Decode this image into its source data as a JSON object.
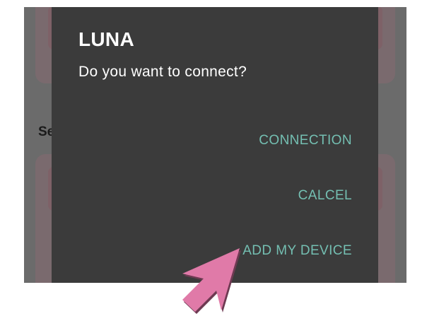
{
  "background": {
    "section_label": "Se"
  },
  "dialog": {
    "title": "LUNA",
    "message": "Do you want to connect?",
    "actions": [
      {
        "label": "CONNECTION"
      },
      {
        "label": "CALCEL"
      },
      {
        "label": "ADD MY DEVICE"
      }
    ]
  },
  "colors": {
    "dialog_bg": "#3b3b3b",
    "accent": "#74bfb2",
    "scrim": "#6b6b6b",
    "pointer": "#e07aa8"
  },
  "icons": {
    "pointer": "pointer-arrow-icon"
  }
}
